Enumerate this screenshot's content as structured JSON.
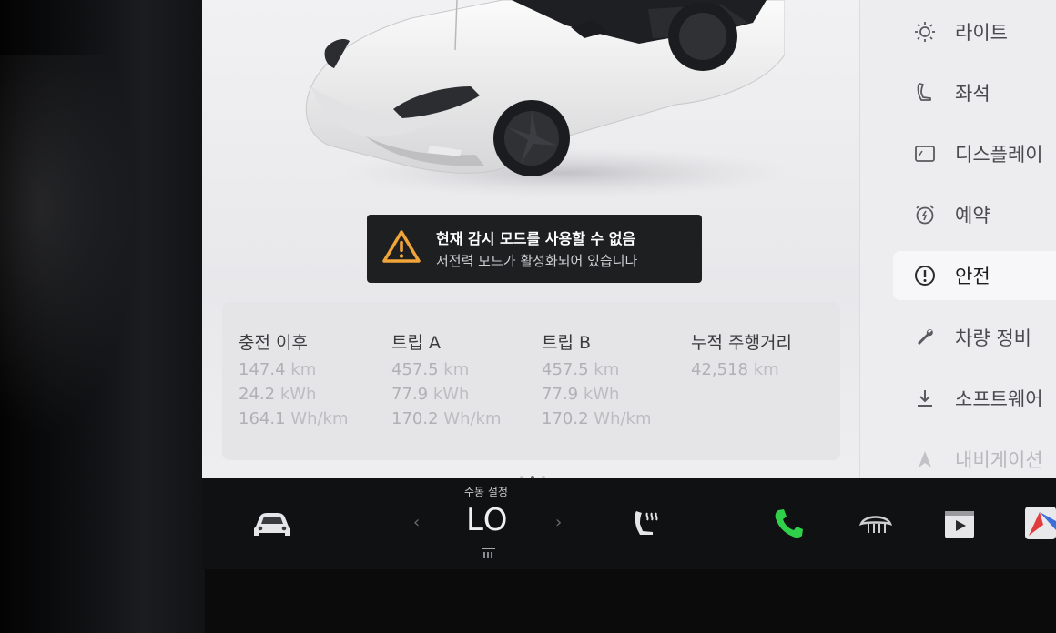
{
  "alert": {
    "title": "현재 감시 모드를 사용할 수 없음",
    "message": "저전력 모드가 활성화되어 있습니다",
    "icon": "warning-icon",
    "icon_color": "#f0a43a"
  },
  "trips": [
    {
      "title": "충전 이후",
      "distance": "147.4",
      "distance_unit": "km",
      "energy": "24.2",
      "energy_unit": "kWh",
      "efficiency": "164.1",
      "efficiency_unit": "Wh/km"
    },
    {
      "title": "트립 A",
      "distance": "457.5",
      "distance_unit": "km",
      "energy": "77.9",
      "energy_unit": "kWh",
      "efficiency": "170.2",
      "efficiency_unit": "Wh/km"
    },
    {
      "title": "트립 B",
      "distance": "457.5",
      "distance_unit": "km",
      "energy": "77.9",
      "energy_unit": "kWh",
      "efficiency": "170.2",
      "efficiency_unit": "Wh/km"
    },
    {
      "title": "누적 주행거리",
      "distance": "42,518",
      "distance_unit": "km"
    }
  ],
  "sidebar": {
    "items": [
      {
        "label": "라이트",
        "icon": "light-icon"
      },
      {
        "label": "좌석",
        "icon": "seat-icon"
      },
      {
        "label": "디스플레이",
        "icon": "display-icon"
      },
      {
        "label": "예약",
        "icon": "schedule-icon"
      },
      {
        "label": "안전",
        "icon": "safety-icon",
        "selected": true
      },
      {
        "label": "차량 정비",
        "icon": "wrench-icon"
      },
      {
        "label": "소프트웨어",
        "icon": "download-icon"
      },
      {
        "label": "내비게이션",
        "icon": "navigation-icon"
      }
    ]
  },
  "climate": {
    "mode_label": "수동 설정",
    "value": "LO",
    "left_arrow": "‹",
    "right_arrow": "›"
  },
  "bottom_bar": {
    "icons": [
      "car-icon",
      "seat-heater-icon",
      "phone-icon",
      "defrost-icon",
      "media-icon",
      "navigation-app-icon"
    ],
    "phone_color": "#2fd04a"
  },
  "pager": {
    "pages": 3,
    "active": 2
  }
}
